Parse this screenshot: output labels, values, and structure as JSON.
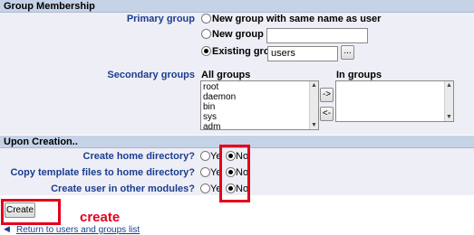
{
  "group_membership": {
    "header": "Group Membership",
    "primary_group": {
      "label": "Primary group",
      "options": [
        {
          "label": "New group with same name as user",
          "selected": false
        },
        {
          "label": "New group",
          "selected": false
        },
        {
          "label": "Existing group",
          "selected": true
        }
      ],
      "new_group_value": "",
      "existing_group_value": "users",
      "browse_label": "..."
    },
    "secondary_groups": {
      "label": "Secondary groups",
      "all_groups_label": "All groups",
      "in_groups_label": "In groups",
      "all_groups": [
        "root",
        "daemon",
        "bin",
        "sys",
        "adm"
      ],
      "in_groups": [],
      "add_label": "->",
      "remove_label": "<-"
    }
  },
  "upon_creation": {
    "header": "Upon Creation..",
    "rows": [
      {
        "label": "Create home directory?",
        "yes": "Ye",
        "no": "No",
        "selected": "No"
      },
      {
        "label": "Copy template files to home directory?",
        "yes": "Ye",
        "no": "No",
        "selected": "No"
      },
      {
        "label": "Create user in other modules?",
        "yes": "Ye",
        "no": "No",
        "selected": "No"
      }
    ]
  },
  "footer": {
    "create_label": "Create",
    "annotation": "create",
    "return_link": "Return to users and groups list"
  },
  "colors": {
    "highlight": "#e3001b",
    "label": "#1a3d8f",
    "header_bg": "#c6d3e7",
    "body_bg": "#eeeef6"
  }
}
